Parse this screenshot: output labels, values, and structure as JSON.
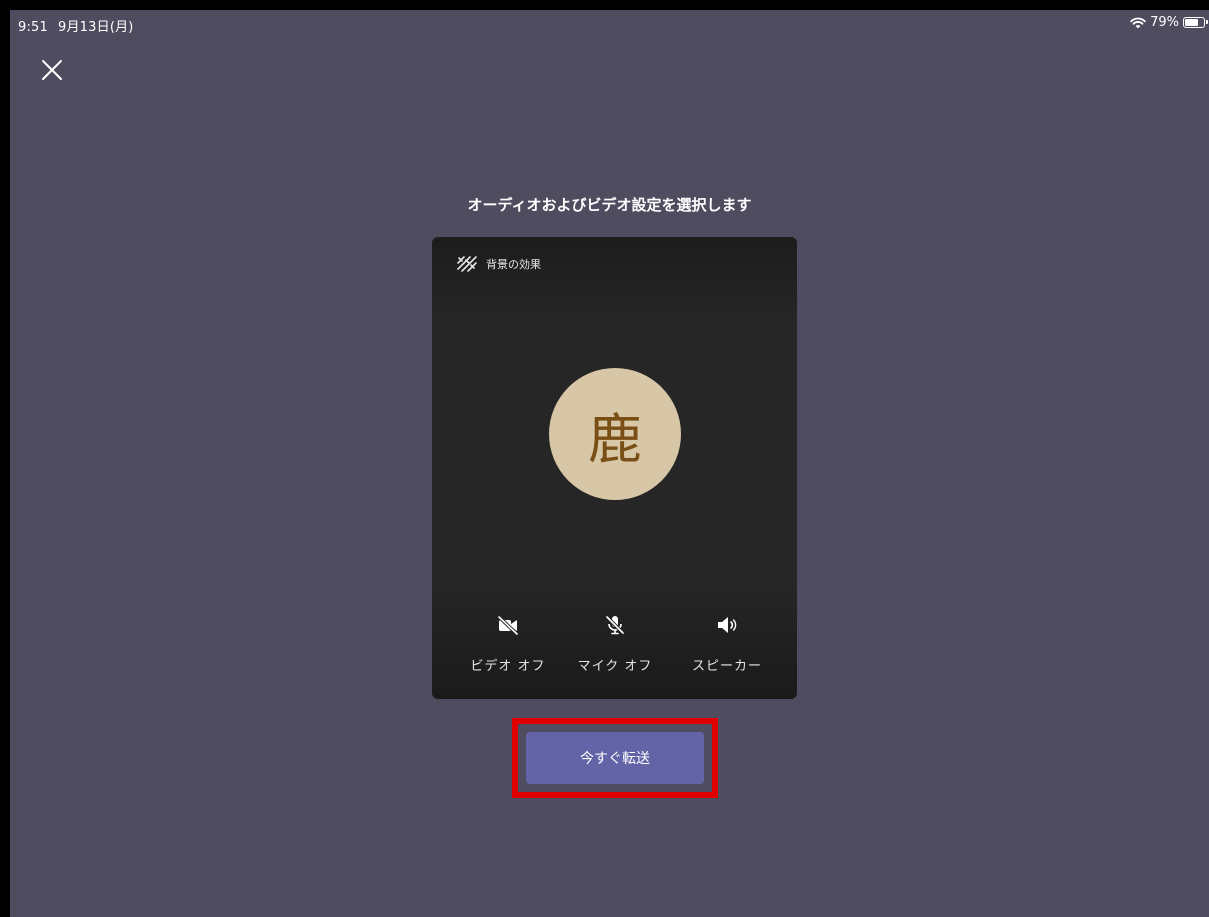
{
  "status_bar": {
    "time": "9:51",
    "date": "9月13日(月)",
    "battery_percent": "79%",
    "battery_level": 0.79
  },
  "dialog": {
    "title": "オーディオおよびビデオ設定を選択します",
    "background_effects_label": "背景の効果",
    "avatar_initial": "鹿",
    "controls": {
      "video_label": "ビデオ オフ",
      "mic_label": "マイク オフ",
      "speaker_label": "スピーカー"
    },
    "transfer_button_label": "今すぐ転送"
  },
  "colors": {
    "background": "#504c60",
    "card": "#262626",
    "avatar_bg": "#d7c7a6",
    "avatar_text": "#7a4f15",
    "primary_button": "#6264a7",
    "highlight_border": "#e00000"
  },
  "icons": {
    "close": "close-icon",
    "background_effects": "background-effects-icon",
    "video_off": "video-off-icon",
    "mic_off": "mic-off-icon",
    "speaker": "speaker-icon",
    "wifi": "wifi-icon",
    "battery": "battery-icon"
  }
}
